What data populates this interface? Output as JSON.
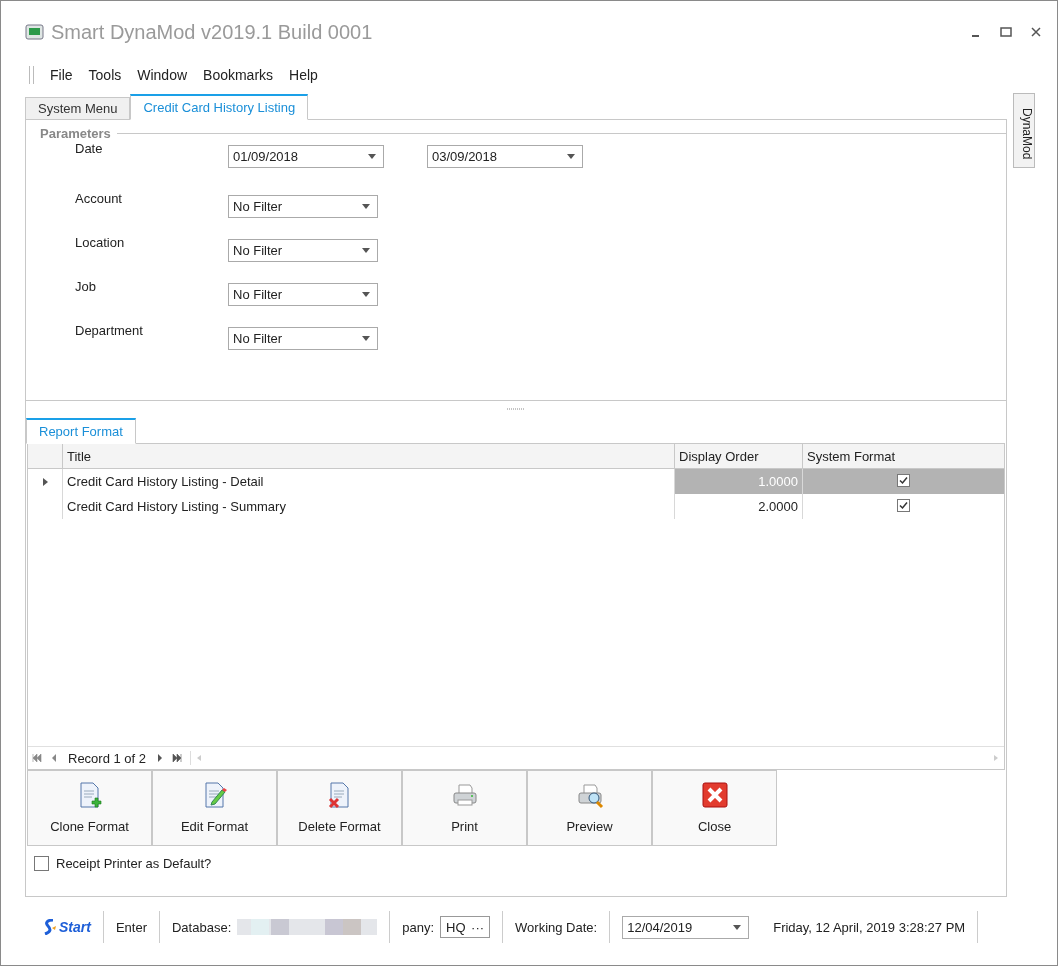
{
  "window": {
    "title": "Smart DynaMod v2019.1 Build 0001"
  },
  "menu": [
    {
      "label": "File"
    },
    {
      "label": "Tools"
    },
    {
      "label": "Window"
    },
    {
      "label": "Bookmarks"
    },
    {
      "label": "Help"
    }
  ],
  "tabs": [
    {
      "label": "System Menu",
      "selected": false
    },
    {
      "label": "Credit Card History Listing",
      "selected": true
    }
  ],
  "side_tab": {
    "label": "DynaMod"
  },
  "parameters": {
    "title": "Parameters",
    "rows": [
      {
        "label": "Date",
        "fields": [
          "01/09/2018",
          "03/09/2018"
        ]
      },
      {
        "label": "Account",
        "fields": [
          "No Filter"
        ]
      },
      {
        "label": "Location",
        "fields": [
          "No Filter"
        ]
      },
      {
        "label": "Job",
        "fields": [
          "No Filter"
        ]
      },
      {
        "label": "Department",
        "fields": [
          "No Filter"
        ]
      }
    ]
  },
  "report_tab": {
    "label": "Report Format",
    "selected": true
  },
  "table": {
    "columns": [
      "Title",
      "Display Order",
      "System Format"
    ],
    "rows": [
      {
        "title": "Credit Card History Listing - Detail",
        "order": "1.0000",
        "system": true,
        "selected": true
      },
      {
        "title": "Credit Card History Listing - Summary",
        "order": "2.0000",
        "system": true,
        "selected": false
      }
    ]
  },
  "navigator": {
    "text": "Record 1 of 2"
  },
  "buttons": [
    {
      "label": "Clone Format",
      "kind": "clone"
    },
    {
      "label": "Edit Format",
      "kind": "edit"
    },
    {
      "label": "Delete Format",
      "kind": "delete"
    },
    {
      "label": "Print",
      "kind": "print"
    },
    {
      "label": "Preview",
      "kind": "preview"
    },
    {
      "label": "Close",
      "kind": "close"
    }
  ],
  "receipt_default": {
    "label": "Receipt Printer as Default?",
    "checked": false
  },
  "status_bar": {
    "start": "Start",
    "edition": "Enter",
    "database_label": "Database:",
    "company_label": "pany:",
    "company": "HQ",
    "company_button": "···",
    "working_date_label": "Working Date:",
    "working_date": "12/04/2019",
    "now": "Friday, 12 April, 2019 3:28:27 PM"
  }
}
